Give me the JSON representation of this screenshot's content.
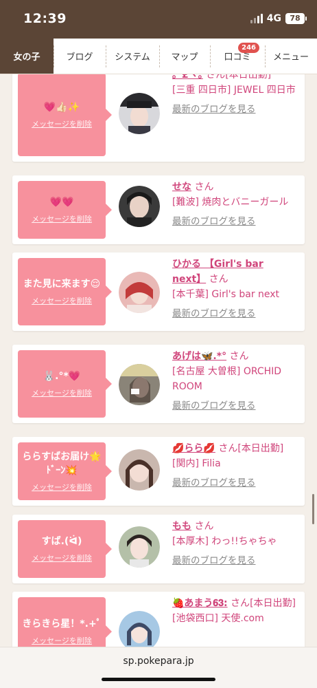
{
  "status": {
    "time": "12:39",
    "network": "4G",
    "battery": "78"
  },
  "tabs": [
    {
      "label": "女の子",
      "active": true
    },
    {
      "label": "ブログ"
    },
    {
      "label": "システム"
    },
    {
      "label": "マップ"
    },
    {
      "label": "口コミ",
      "badge": "246"
    },
    {
      "label": "メニュー"
    }
  ],
  "delete_label": "メッセージを削除",
  "more_label": "最新のブログを見る",
  "san": "さん",
  "cards": [
    {
      "message": "💗👍🏻✨",
      "name": "｡ﾟ£ヽ｡",
      "extra": "[本日出勤]",
      "shop": "[三重 四日市] JEWEL 四日市"
    },
    {
      "message": "💗💗",
      "name": "せな",
      "extra": "",
      "shop": "[難波] 焼肉とバニーガール"
    },
    {
      "message": "また見に来ます😌",
      "name": "ひかる 【Girl's bar next】",
      "extra": "",
      "shop": "[本千葉] Girl's bar next"
    },
    {
      "message": "🐰.°*💗",
      "name": "あげは🦋.*°",
      "extra": "",
      "shop": "[名古屋 大曽根] ORCHID ROOM"
    },
    {
      "message": "ららすばお届け🌟ﾄﾞｰﾝ💥",
      "name": "💋らら💋",
      "extra": "[本日出勤]",
      "shop": "[関内] Filia"
    },
    {
      "message": "すば.(ᐛ)",
      "name": "もも",
      "extra": "",
      "shop": "[本厚木] わっ!!ちゃちゃ"
    },
    {
      "message": "きらきら星！*.+ﾟ",
      "name": "🍓あまう𝟔𝟑:",
      "extra": "[本日出勤]",
      "shop": "[池袋西口] 天使.com"
    }
  ],
  "url": "sp.pokepara.jp",
  "colors": {
    "header": "#5b4536",
    "bubble": "#f7919d",
    "name": "#d0457b",
    "badge": "#e0524f"
  }
}
